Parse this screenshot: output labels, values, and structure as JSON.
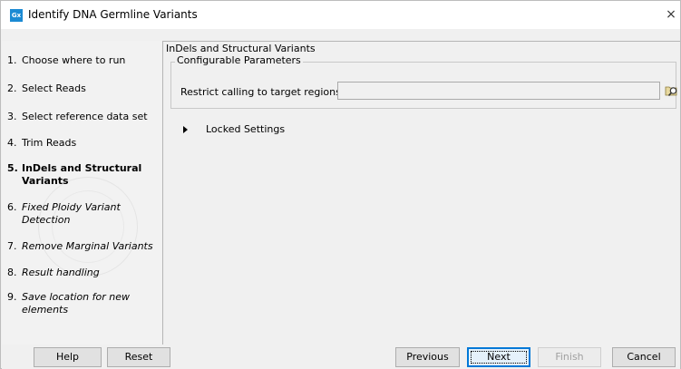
{
  "window": {
    "app_icon_text": "Gx",
    "title": "Identify DNA Germline Variants",
    "close_glyph": "×"
  },
  "steps": [
    {
      "num": "1.",
      "label": "Choose where to run",
      "style": "normal"
    },
    {
      "num": "2.",
      "label": "Select Reads",
      "style": "normal"
    },
    {
      "num": "3.",
      "label": "Select reference data set",
      "style": "normal"
    },
    {
      "num": "4.",
      "label": "Trim Reads",
      "style": "normal"
    },
    {
      "num": "5.",
      "label": "InDels and Structural Variants",
      "style": "bold"
    },
    {
      "num": "6.",
      "label": "Fixed Ploidy Variant Detection",
      "style": "italic"
    },
    {
      "num": "7.",
      "label": "Remove Marginal Variants",
      "style": "italic"
    },
    {
      "num": "8.",
      "label": "Result handling",
      "style": "italic"
    },
    {
      "num": "9.",
      "label": "Save location for new elements",
      "style": "italic"
    }
  ],
  "panel": {
    "title": "InDels and Structural Variants",
    "group_title": "Configurable Parameters",
    "field_label": "Restrict calling to target regions",
    "field_value": "",
    "browse_icon": "folder-search-icon",
    "locked_label": "Locked Settings"
  },
  "buttons": {
    "help": "Help",
    "reset": "Reset",
    "previous": "Previous",
    "next": "Next",
    "finish": "Finish",
    "cancel": "Cancel"
  },
  "colors": {
    "accent": "#0078d7",
    "app_icon": "#1b8ad3",
    "disabled_text": "#a0a0a0"
  }
}
